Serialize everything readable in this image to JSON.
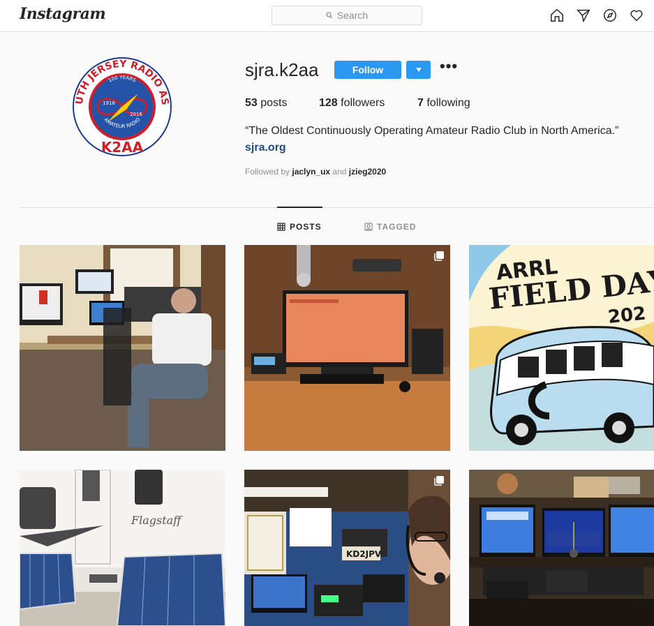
{
  "nav": {
    "logo": "Instagram",
    "search_placeholder": "Search",
    "icons": [
      "home-icon",
      "direct-icon",
      "explore-icon",
      "activity-heart-icon"
    ]
  },
  "avatar": {
    "ring_text_top": "SOUTH JERSEY RADIO ASSN",
    "ring_text_bottom": "K2AA",
    "inner_top": "100 YEARS",
    "inner_left_year": "1916",
    "inner_right_year": "2016",
    "inner_bottom": "AMATEUR RADIO"
  },
  "profile": {
    "username": "sjra.k2aa",
    "follow_label": "Follow",
    "more_label": "•••",
    "stats": {
      "posts_count": "53",
      "posts_label": "posts",
      "followers_count": "128",
      "followers_label": "followers",
      "following_count": "7",
      "following_label": "following"
    },
    "bio": "“The Oldest Continuously Operating Amateur Radio Club in North America.”",
    "link": "sjra.org",
    "followed_prefix": "Followed by",
    "followed_user1": "jaclyn_ux",
    "followed_and": "and",
    "followed_user2": "jzieg2020"
  },
  "tabs": {
    "posts": "POSTS",
    "tagged": "TAGGED"
  },
  "posts": {
    "p3_line1": "ARRL",
    "p3_line2": "FIELD DAY",
    "p3_line3": "202",
    "p5_callsign": "KD2JPV"
  },
  "colors": {
    "follow_blue": "#2a97f0",
    "link_blue": "#1f4d82",
    "border": "#dbdbdb"
  }
}
